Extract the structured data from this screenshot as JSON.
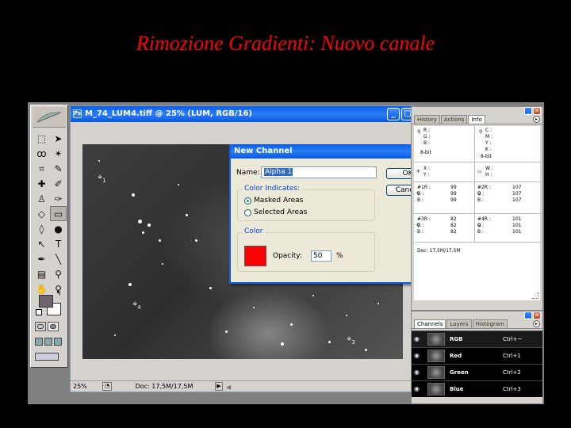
{
  "slide_title": "Rimozione Gradienti: Nuovo canale",
  "document": {
    "title": "M_74_LUM4.tiff @ 25% (LUM, RGB/16)",
    "zoom": "25%",
    "doc_size": "Doc: 17,5M/17,5M",
    "markers": [
      "1",
      "4",
      "3"
    ]
  },
  "dialog": {
    "title": "New Channel",
    "name_label": "Name:",
    "name_value": "Alpha 1",
    "ok_label": "OK",
    "cancel_label": "Cancel",
    "color_indicates_label": "Color Indicates:",
    "option_masked": "Masked Areas",
    "option_selected": "Selected Areas",
    "selected_option": "Masked Areas",
    "color_group_label": "Color",
    "color_value": "#ff0000",
    "opacity_label": "Opacity:",
    "opacity_value": "50",
    "opacity_unit": "%"
  },
  "info_palette": {
    "tabs": [
      "History",
      "Actions",
      "Info"
    ],
    "active_tab": "Info",
    "rgb_block": "R :\nG :\nB :",
    "cmyk_block": "C :\nM :\nY :\nK :",
    "bit_left": "8-bit",
    "bit_right": "8-bit",
    "xy_block": "X :\nY :",
    "wh_block": "W :\nH :",
    "s1_labels": "#1R :\nG :\nB :",
    "s1_values": "99\n99\n99",
    "s2_labels": "#2R :\nG :\nB :",
    "s2_values": "107\n107\n107",
    "s3_labels": "#3R :\nG :\nB :",
    "s3_values": "82\n82\n82",
    "s4_labels": "#4R :\nG :\nB :",
    "s4_values": "101\n101\n101",
    "doc_size": "Doc: 17,5M/17,5M"
  },
  "channels_palette": {
    "tabs": [
      "Channels",
      "Layers",
      "Histogram"
    ],
    "active_tab": "Channels",
    "rows": [
      {
        "name": "RGB",
        "shortcut": "Ctrl+~"
      },
      {
        "name": "Red",
        "shortcut": "Ctrl+1"
      },
      {
        "name": "Green",
        "shortcut": "Ctrl+2"
      },
      {
        "name": "Blue",
        "shortcut": "Ctrl+3"
      }
    ]
  },
  "colors": {
    "title_red": "#ff0000",
    "xp_blue": "#0a5ee9",
    "foreground_swatch": "#6e6470"
  }
}
